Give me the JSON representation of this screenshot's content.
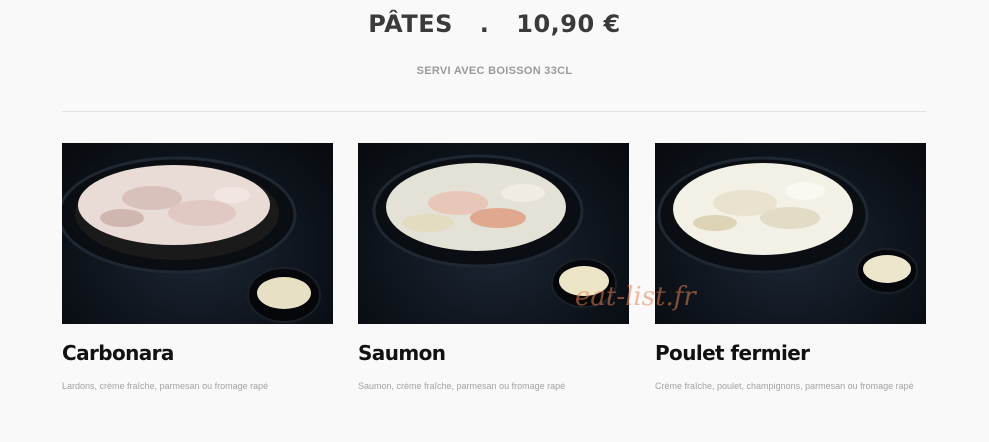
{
  "header": {
    "category": "PÂTES",
    "separator": ".",
    "price": "10,90 €",
    "subtitle": "SERVI AVEC BOISSON 33CL"
  },
  "items": [
    {
      "name": "Carbonara",
      "description": "Lardons, crème fraîche, parmesan ou fromage rapé",
      "image": "carbonara-pasta-bowl"
    },
    {
      "name": "Saumon",
      "description": "Saumon, crème fraîche, parmesan ou fromage rapé",
      "image": "salmon-pasta-bowl"
    },
    {
      "name": "Poulet fermier",
      "description": "Crème fraîche, poulet, champignons, parmesan ou fromage rapé",
      "image": "chicken-pasta-bowl"
    }
  ],
  "watermark": "eat-list.fr",
  "colors": {
    "background": "#f9f9f9",
    "title": "#3a3a3a",
    "subtitle": "#9a9a9a",
    "item_name": "#111111",
    "description": "#a3a3a3",
    "watermark": "#e88250"
  }
}
